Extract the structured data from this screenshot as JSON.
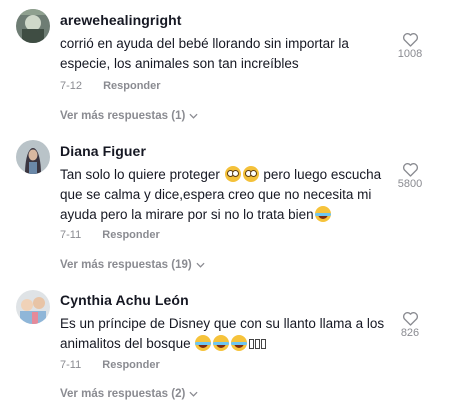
{
  "comments": [
    {
      "username": "arewehealingright",
      "text": "corrió en ayuda del bebé llorando sin importar la especie, los animales son tan increíbles",
      "date": "7-12",
      "reply_label": "Responder",
      "likes": "1008",
      "more_replies": "Ver más respuestas (1)"
    },
    {
      "username": "Diana Figuer",
      "text_parts": [
        "Tan solo lo quiere proteger ",
        " pero luego escucha que se calma y dice,espera creo que no necesita mi ayuda pero la mirare por si no lo trata bien"
      ],
      "date": "7-11",
      "reply_label": "Responder",
      "likes": "5800",
      "more_replies": "Ver más respuestas (19)"
    },
    {
      "username": "Cynthia Achu León",
      "text": "Es un príncipe de Disney que con su llanto llama a los animalitos del bosque ",
      "date": "7-11",
      "reply_label": "Responder",
      "likes": "826",
      "more_replies": "Ver más respuestas (2)"
    }
  ],
  "icons": {
    "like": "heart-outline-icon",
    "expand": "chevron-down-icon",
    "emoji_flushed": "flushed-face-emoji",
    "emoji_laugh": "tears-of-joy-emoji"
  },
  "colors": {
    "text": "#161823",
    "muted": "#8a8b91"
  }
}
